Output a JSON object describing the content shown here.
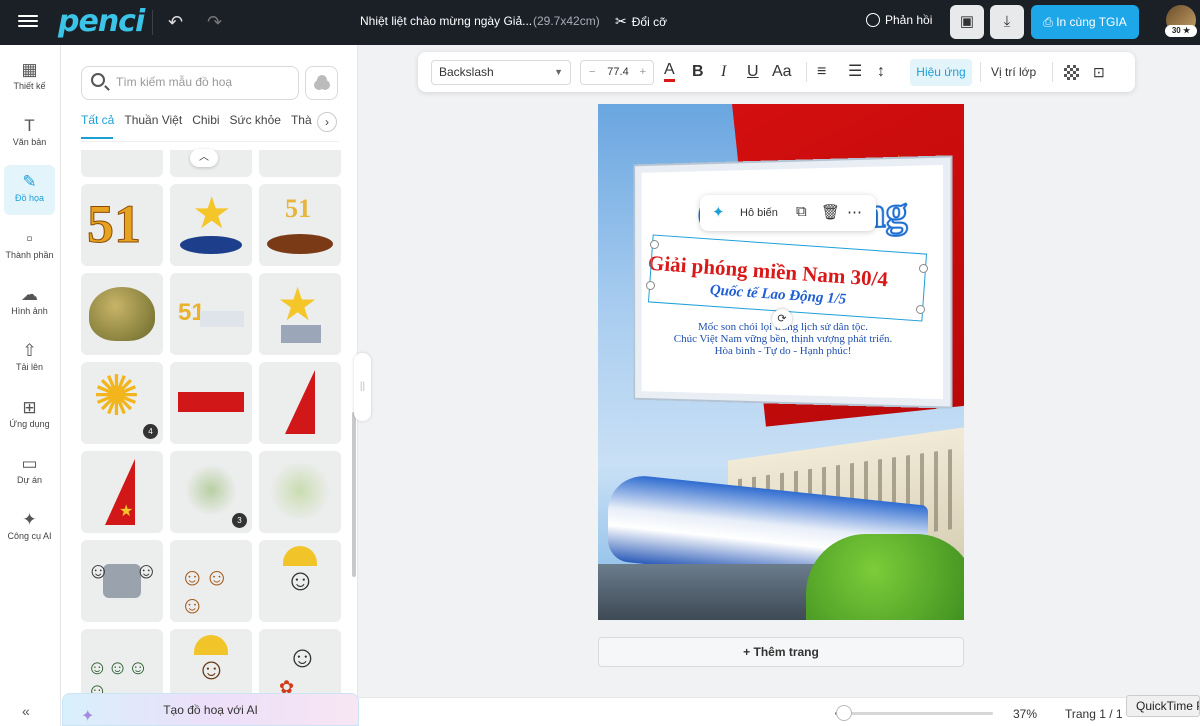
{
  "app": {
    "logo": "penci"
  },
  "header": {
    "doc_title": "Nhiệt liệt chào mừng ngày Giả...",
    "doc_size": "(29.7x42cm)",
    "resize_label": "Đổi cỡ",
    "feedback_label": "Phản hồi",
    "print_label": "In cùng TGIA",
    "avatar_badge": "30 ★"
  },
  "nav": {
    "items": [
      {
        "label": "Thiết kế",
        "icon": "layout-icon",
        "glyph": "▦"
      },
      {
        "label": "Văn bản",
        "icon": "text-icon",
        "glyph": "T"
      },
      {
        "label": "Đồ họa",
        "icon": "brush-icon",
        "glyph": "✎"
      },
      {
        "label": "Thành phần",
        "icon": "components-icon",
        "glyph": "▫"
      },
      {
        "label": "Hình ảnh",
        "icon": "image-icon",
        "glyph": "☁"
      },
      {
        "label": "Tải lên",
        "icon": "upload-icon",
        "glyph": "⇧"
      },
      {
        "label": "Ứng dụng",
        "icon": "apps-icon",
        "glyph": "⊞"
      },
      {
        "label": "Dự án",
        "icon": "folder-icon",
        "glyph": "▭"
      },
      {
        "label": "Công cụ AI",
        "icon": "sparkle-icon",
        "glyph": "✦"
      }
    ],
    "active_index": 2,
    "collapse_glyph": "«"
  },
  "panel": {
    "search_placeholder": "Tìm kiếm mẫu đồ hoạ",
    "categories": [
      "Tất cả",
      "Thuần Việt",
      "Chibi",
      "Sức khỏe",
      "Thà"
    ],
    "active_category": 0,
    "tiles": [
      {
        "name": "number-51-gold",
        "count": ""
      },
      {
        "name": "gold-star-blue-base",
        "count": ""
      },
      {
        "name": "gold-51-bronze-base",
        "count": ""
      },
      {
        "name": "soldier-helmet",
        "count": ""
      },
      {
        "name": "51-palace",
        "count": ""
      },
      {
        "name": "star-flag-building",
        "count": ""
      },
      {
        "name": "sunflower",
        "count": "4"
      },
      {
        "name": "red-ribbon",
        "count": ""
      },
      {
        "name": "red-flag-corner",
        "count": ""
      },
      {
        "name": "red-flag-star",
        "count": ""
      },
      {
        "name": "green-leaves",
        "count": "3"
      },
      {
        "name": "green-watercolor",
        "count": ""
      },
      {
        "name": "chibi-workers-pot",
        "count": ""
      },
      {
        "name": "chibi-workers-sitting",
        "count": ""
      },
      {
        "name": "chibi-worker-cheer",
        "count": ""
      },
      {
        "name": "chibi-group",
        "count": ""
      },
      {
        "name": "chibi-worker-wrench",
        "count": ""
      },
      {
        "name": "chibi-girl-flowers",
        "count": ""
      }
    ],
    "ai_label": "Tạo đồ hoạ với AI"
  },
  "toolbar": {
    "font": "Backslash",
    "font_size": "77.4",
    "minus": "−",
    "plus": "+",
    "effects_label": "Hiệu ứng",
    "position_label": "Vị trí lớp"
  },
  "poster": {
    "title": "Chào mừng",
    "heading": "Giải phóng miền Nam 30/4",
    "subheading": "Quốc tế Lao Động 1/5",
    "body_lines": [
      "Mốc son chói lọi trong lịch sử dân tộc.",
      "Chúc Việt Nam vững bền, thịnh vượng phát triển.",
      "Hòa bình - Tự do - Hạnh phúc!"
    ]
  },
  "context_menu": {
    "magic_label": "Hô biến"
  },
  "canvas": {
    "add_page_label": "+ Thêm trang"
  },
  "footer": {
    "zoom_value": "37%",
    "zoom_fraction": 0.06,
    "page_indicator": "Trang 1 / 1",
    "quicktime_label": "QuickTime P"
  },
  "colors": {
    "accent": "#1e9fd8",
    "topbar": "#1b2027",
    "print_button": "#1ea7e8",
    "poster_red": "#d91818",
    "poster_blue": "#1f5fd3"
  }
}
